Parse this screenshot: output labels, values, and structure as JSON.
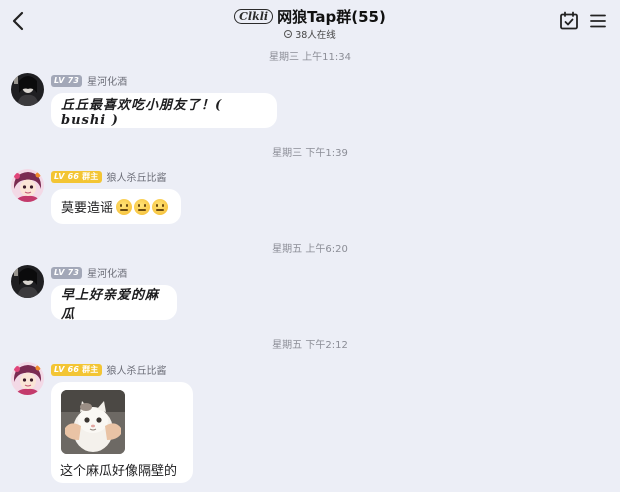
{
  "header": {
    "group_logo": "Clkli",
    "title": "网狼Tap群(55)",
    "online": "38人在线"
  },
  "messages": [
    {
      "timestamp": "星期三 上午11:34",
      "sender": "星河化酒",
      "level": "LV 73",
      "role": "",
      "text": "丘丘最喜欢吃小朋友了！( bushi )"
    },
    {
      "timestamp": "星期三 下午1:39",
      "sender": "狼人杀丘比酱",
      "level": "LV 66",
      "role": "群主",
      "text": "莫要造谣"
    },
    {
      "timestamp": "星期五 上午6:20",
      "sender": "星河化酒",
      "level": "LV 73",
      "role": "",
      "text": "早上好亲爱的麻瓜"
    },
    {
      "timestamp": "星期五 下午2:12",
      "sender": "狼人杀丘比酱",
      "level": "LV 66",
      "role": "群主",
      "text": "这个麻瓜好像隔壁的"
    }
  ],
  "colors": {
    "background": "#eceef6",
    "bubble": "#ffffff",
    "badge_grey": "#a3a8b8",
    "badge_gold": "#f3c534"
  },
  "icons": [
    "back-icon",
    "calendar-check-icon",
    "menu-icon",
    "online-users-icon",
    "confused-face-emoji"
  ]
}
